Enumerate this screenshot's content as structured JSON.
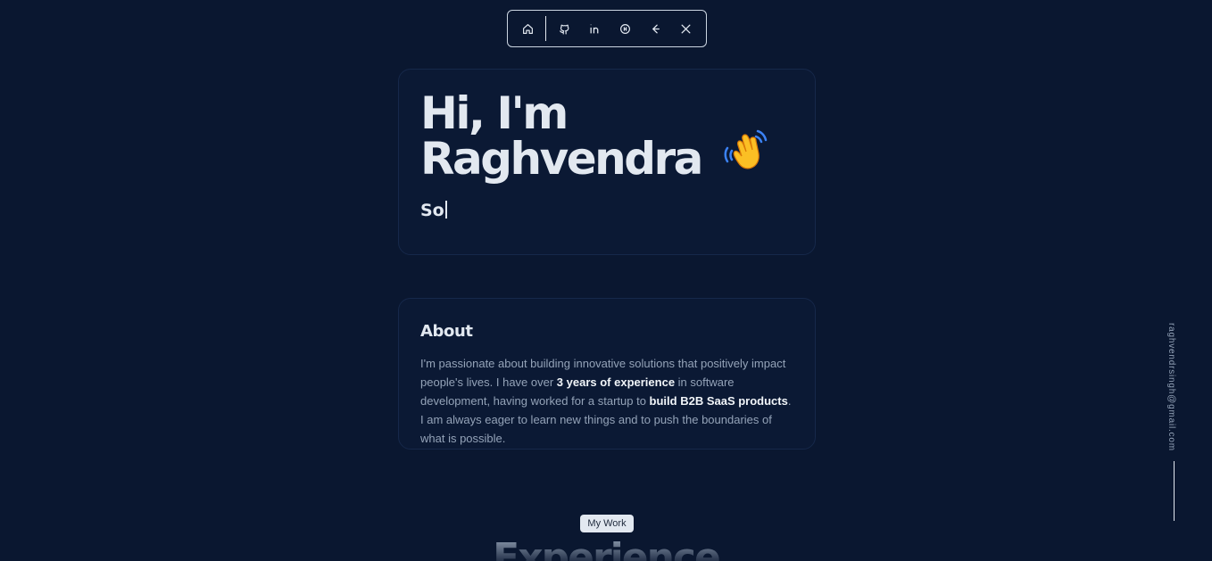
{
  "nav": {
    "items": [
      {
        "icon": "home-icon"
      },
      {
        "icon": "github-icon"
      },
      {
        "icon": "linkedin-icon"
      },
      {
        "icon": "hashnode-icon"
      },
      {
        "icon": "leetcode-icon"
      },
      {
        "icon": "x-icon"
      }
    ]
  },
  "hero": {
    "title_line1": "Hi, I'm",
    "title_line2": "Raghvendra",
    "typed_text": "So"
  },
  "about": {
    "title": "About",
    "text_1": "I'm passionate about building innovative solutions that positively impact people's lives. I have over ",
    "bold_1": "3 years of experience",
    "text_2": " in software development, having worked for a startup to ",
    "bold_2": "build B2B SaaS products",
    "text_3": ". I am always eager to learn new things and to push the boundaries of what is possible."
  },
  "side": {
    "email": "raghvendrsingh@gmail.com"
  },
  "work": {
    "pill": "My Work",
    "section_title": "Experience"
  },
  "colors": {
    "background": "#0a1730",
    "card": "#0b1934",
    "text": "#e2e8f0",
    "muted": "#94a3b8"
  }
}
